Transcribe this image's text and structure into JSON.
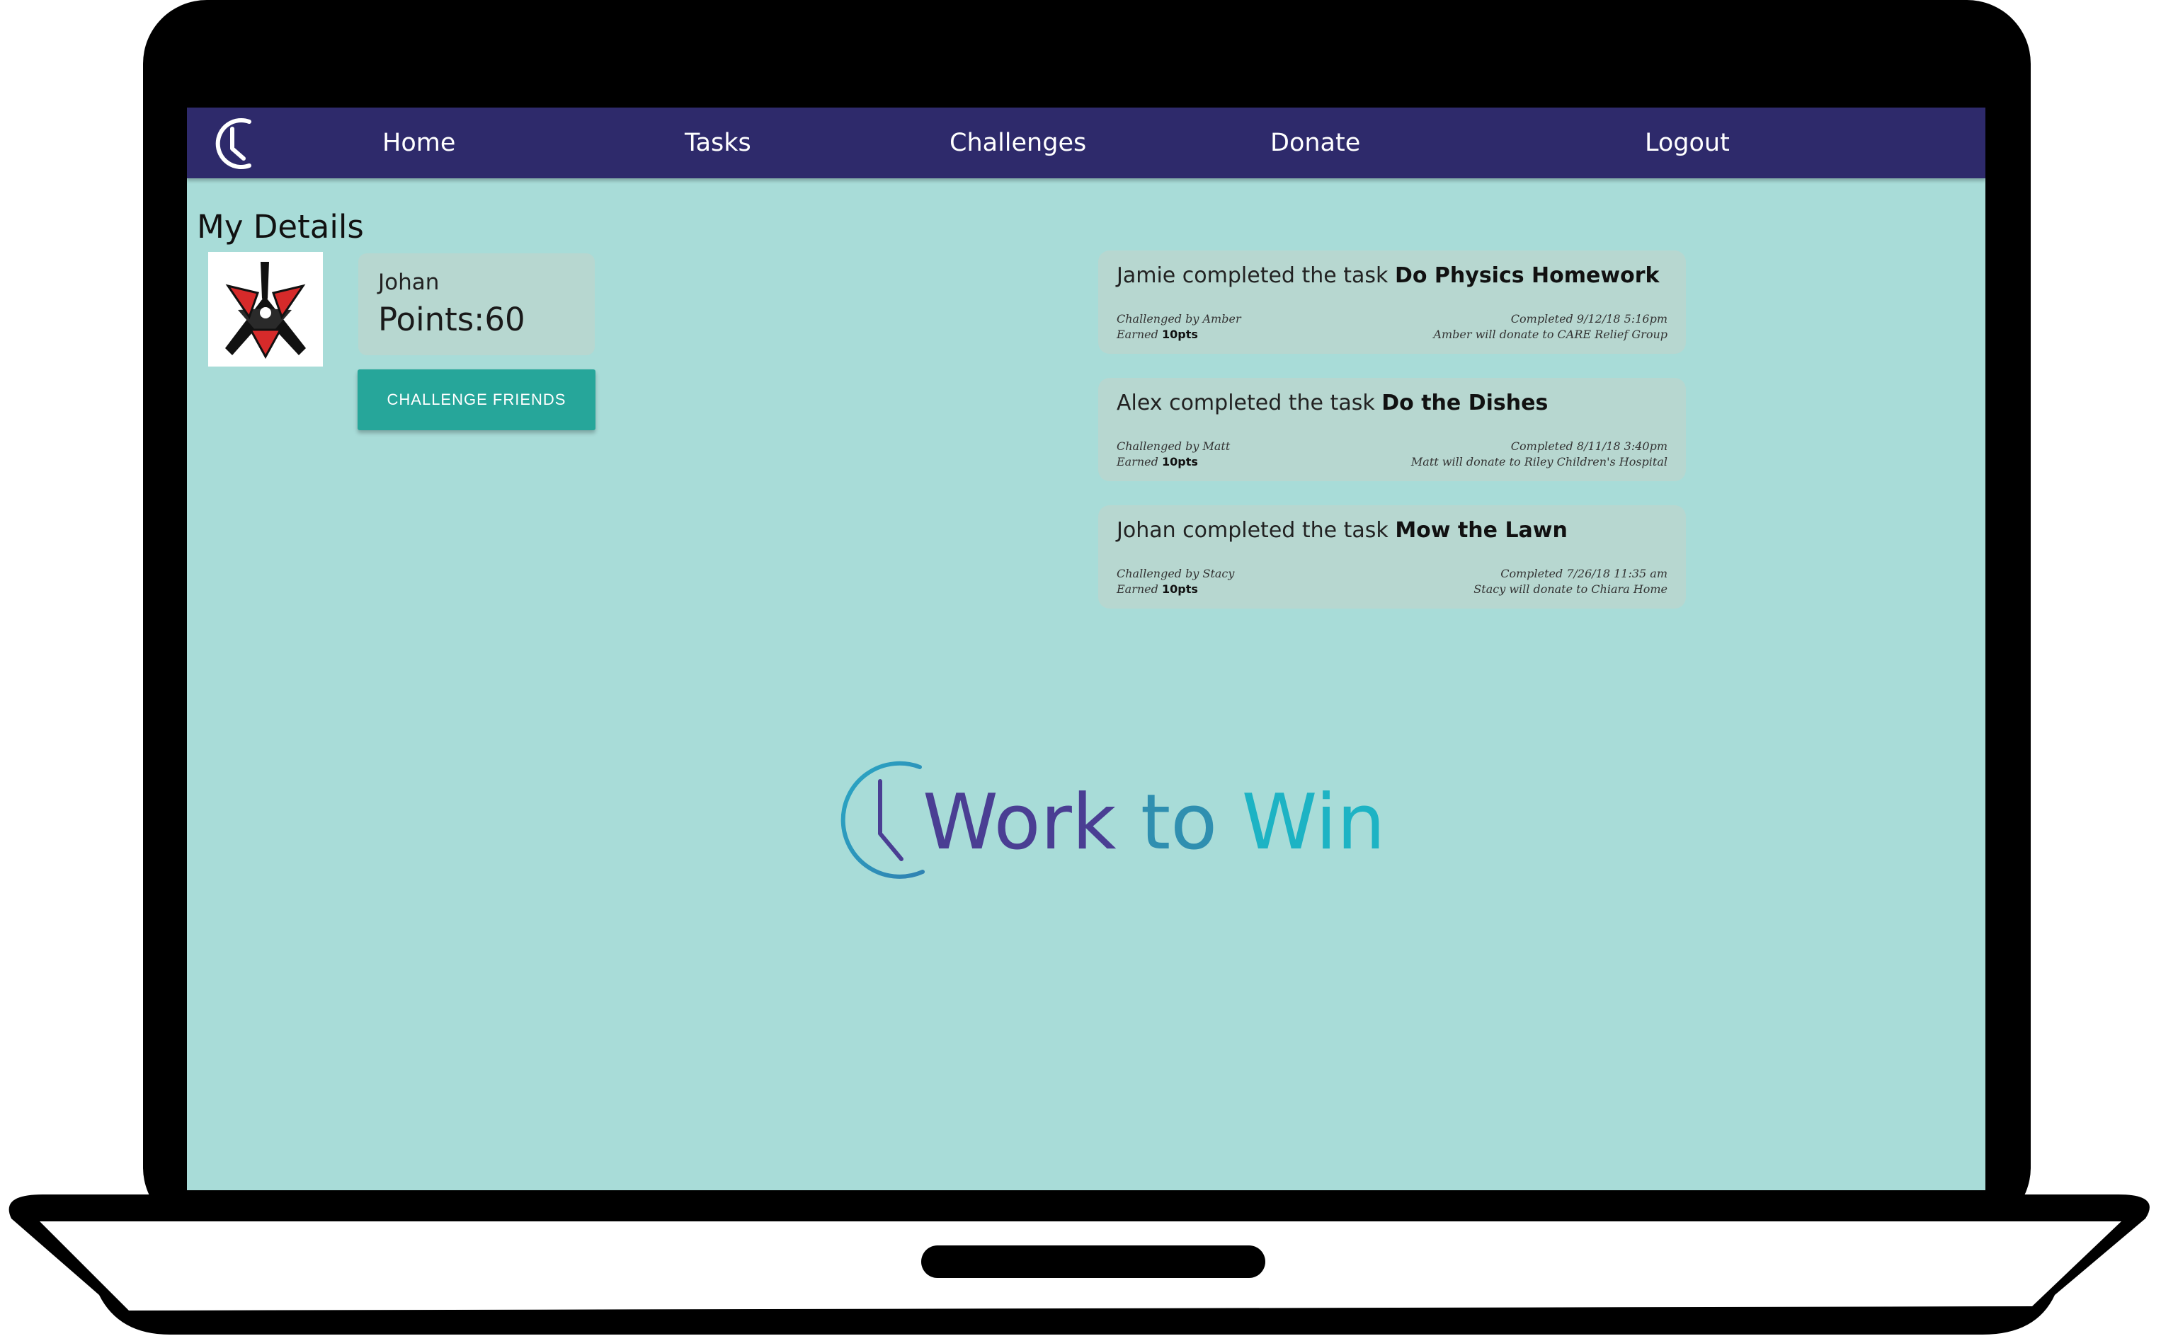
{
  "nav": {
    "items": [
      {
        "label": "Home"
      },
      {
        "label": "Tasks"
      },
      {
        "label": "Challenges"
      },
      {
        "label": "Donate"
      },
      {
        "label": "Logout"
      }
    ],
    "logo_icon": "clock-icon"
  },
  "details": {
    "title": "My Details",
    "user_name": "Johan",
    "points": "Points:60",
    "avatar_icon": "emblem-avatar",
    "challenge_button": "CHALLENGE FRIENDS"
  },
  "feed": [
    {
      "prefix": "Jamie completed the task",
      "task": "Do Physics Homework",
      "challenged_by": "Challenged by Amber",
      "earned_label": "Earned",
      "earned_points": "10pts",
      "completed": "Completed 9/12/18 5:16pm",
      "donation": "Amber will donate to CARE Relief Group"
    },
    {
      "prefix": "Alex completed the task",
      "task": "Do the Dishes",
      "challenged_by": "Challenged by Matt",
      "earned_label": "Earned",
      "earned_points": "10pts",
      "completed": "Completed 8/11/18 3:40pm",
      "donation": "Matt will donate to Riley Children's Hospital"
    },
    {
      "prefix": "Johan completed the task",
      "task": "Mow the Lawn",
      "challenged_by": "Challenged by Stacy",
      "earned_label": "Earned",
      "earned_points": "10pts",
      "completed": "Completed 7/26/18 11:35 am",
      "donation": "Stacy will donate to Chiara Home"
    }
  ],
  "brand": {
    "word1": "Work",
    "word2": "to",
    "word3": "Win"
  },
  "colors": {
    "navbar": "#2e2a6b",
    "background": "#a8dcd8",
    "card": "#b7d7d0",
    "button": "#26a69a"
  }
}
